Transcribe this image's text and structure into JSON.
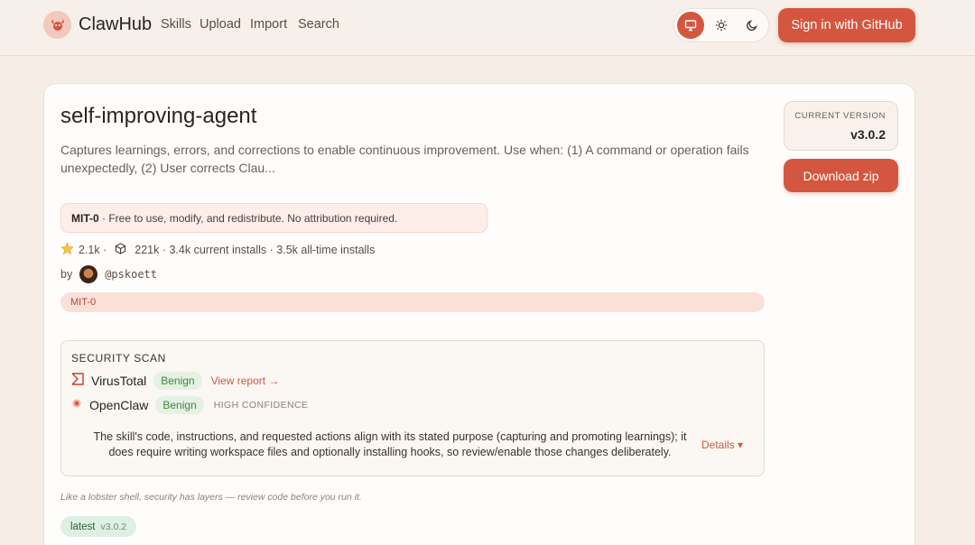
{
  "header": {
    "brand": "ClawHub",
    "nav": [
      "Skills",
      "Upload",
      "Import",
      "Search"
    ],
    "theme_options": [
      "monitor-icon",
      "sun-icon",
      "moon-icon"
    ],
    "signin_label": "Sign in  with GitHub",
    "accent_color": "#d4563f"
  },
  "skill": {
    "title": "self-improving-agent",
    "description": "Captures learnings, errors, and corrections to enable continuous improvement. Use when: (1) A command or operation fails unexpectedly, (2) User corrects Clau...",
    "license_name": "MIT-0",
    "license_text": " · Free to use, modify, and redistribute. No attribution required.",
    "stars": "2.1k ·",
    "installs": "221k · 3.4k current installs · 3.5k all-time installs",
    "by_label": "by",
    "author": "@pskoett",
    "tag": "MIT-0"
  },
  "security": {
    "heading": "SECURITY SCAN",
    "scanners": [
      {
        "name": "VirusTotal",
        "verdict": "Benign",
        "link": "View report →"
      },
      {
        "name": "OpenClaw",
        "verdict": "Benign",
        "confidence": "HIGH CONFIDENCE"
      }
    ],
    "summary": "The skill's code, instructions, and requested actions align with its stated purpose (capturing and promoting learnings); it does require writing workspace files and optionally installing hooks, so review/enable those changes deliberately.",
    "details_label": "Details ▾",
    "note": "Like a lobster shell, security has layers — review code before you run it."
  },
  "version_tag": {
    "name": "latest",
    "version": "v3.0.2"
  },
  "sidebar": {
    "current_version_label": "CURRENT VERSION",
    "current_version": "v3.0.2",
    "download_label": "Download zip"
  }
}
